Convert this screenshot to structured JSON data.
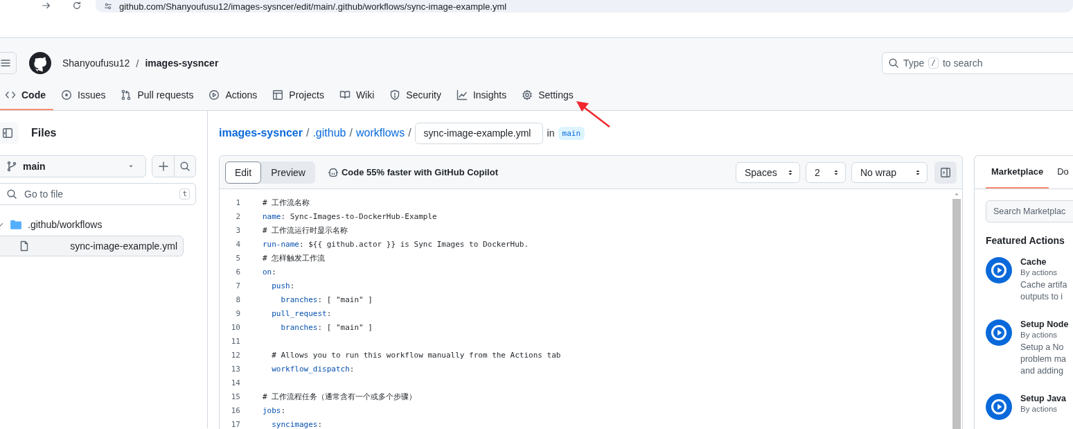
{
  "browser": {
    "address": "github.com/Shanyoufusu12/images-sysncer/edit/main/.github/workflows/sync-image-example.yml"
  },
  "header": {
    "owner": "Shanyoufusu12",
    "separator": "/",
    "repo": "images-sysncer",
    "search": {
      "placeholder_before": "Type",
      "key": "/",
      "placeholder_after": "to search"
    }
  },
  "tabs": [
    {
      "label": "Code",
      "kind": "code",
      "selected": true
    },
    {
      "label": "Issues",
      "kind": "issue",
      "selected": false
    },
    {
      "label": "Pull requests",
      "kind": "pr",
      "selected": false
    },
    {
      "label": "Actions",
      "kind": "play",
      "selected": false
    },
    {
      "label": "Projects",
      "kind": "table",
      "selected": false
    },
    {
      "label": "Wiki",
      "kind": "book",
      "selected": false
    },
    {
      "label": "Security",
      "kind": "shield",
      "selected": false
    },
    {
      "label": "Insights",
      "kind": "graph",
      "selected": false
    },
    {
      "label": "Settings",
      "kind": "gear",
      "selected": false
    }
  ],
  "sidebar": {
    "title": "Files",
    "branch": "main",
    "filter": {
      "placeholder": "Go to file",
      "shortcut": "t"
    },
    "tree": [
      {
        "name": ".github/workflows",
        "kind": "folder",
        "expanded": true,
        "selected": false,
        "children": [
          {
            "name": "sync-image-example.yml",
            "kind": "file",
            "selected": true
          }
        ]
      }
    ]
  },
  "breadcrumb": {
    "parts": [
      "images-sysncer",
      ".github",
      "workflows"
    ],
    "separator": "/",
    "filename": "sync-image-example.yml",
    "in_label": "in",
    "branch": "main"
  },
  "editor": {
    "modes": [
      {
        "label": "Edit",
        "selected": true
      },
      {
        "label": "Preview",
        "selected": false
      }
    ],
    "copilot": "Code 55% faster with GitHub Copilot",
    "selects": [
      "Spaces",
      "2",
      "No wrap"
    ],
    "lines": [
      {
        "number": "1",
        "kind": "comment",
        "text": "# 工作流名称"
      },
      {
        "number": "2",
        "kind": "pair",
        "key": "name",
        "value": ": Sync-Images-to-DockerHub-Example"
      },
      {
        "number": "3",
        "kind": "comment",
        "text": "# 工作流运行时显示名称"
      },
      {
        "number": "4",
        "kind": "pair",
        "key": "run-name",
        "value": ": ${{ github.actor }} is Sync Images to DockerHub."
      },
      {
        "number": "5",
        "kind": "comment",
        "text": "# 怎样触发工作流"
      },
      {
        "number": "6",
        "kind": "pair",
        "key": "on",
        "value": ":"
      },
      {
        "number": "7",
        "kind": "pair",
        "key": "  push",
        "value": ":"
      },
      {
        "number": "8",
        "kind": "pair",
        "key": "    branches",
        "value": ": [ \"main\" ]"
      },
      {
        "number": "9",
        "kind": "pair",
        "key": "  pull_request",
        "value": ":"
      },
      {
        "number": "10",
        "kind": "pair",
        "key": "    branches",
        "value": ": [ \"main\" ]"
      },
      {
        "number": "11",
        "kind": "blank"
      },
      {
        "number": "12",
        "kind": "comment",
        "text": "  # Allows you to run this workflow manually from the Actions tab"
      },
      {
        "number": "13",
        "kind": "pair",
        "key": "  workflow_dispatch",
        "value": ":"
      },
      {
        "number": "14",
        "kind": "blank"
      },
      {
        "number": "15",
        "kind": "comment",
        "text": "# 工作流程任务（通常含有一个或多个步骤）"
      },
      {
        "number": "16",
        "kind": "pair",
        "key": "jobs",
        "value": ":"
      },
      {
        "number": "17",
        "kind": "pair",
        "key": "  syncimages",
        "value": ":"
      }
    ]
  },
  "panel": {
    "tabs": [
      {
        "label": "Marketplace",
        "selected": true
      },
      {
        "label": "Do",
        "selected": false
      }
    ],
    "search": {
      "placeholder": "Search Marketplac"
    },
    "heading": "Featured Actions",
    "actions": [
      {
        "name": "Cache",
        "by": "By actions",
        "description": [
          "Cache artifa",
          "outputs to i"
        ]
      },
      {
        "name": "Setup Node",
        "by": "By actions",
        "description": [
          "Setup a No",
          "problem ma",
          "and adding"
        ]
      },
      {
        "name": "Setup Java",
        "by": "By actions"
      }
    ]
  }
}
